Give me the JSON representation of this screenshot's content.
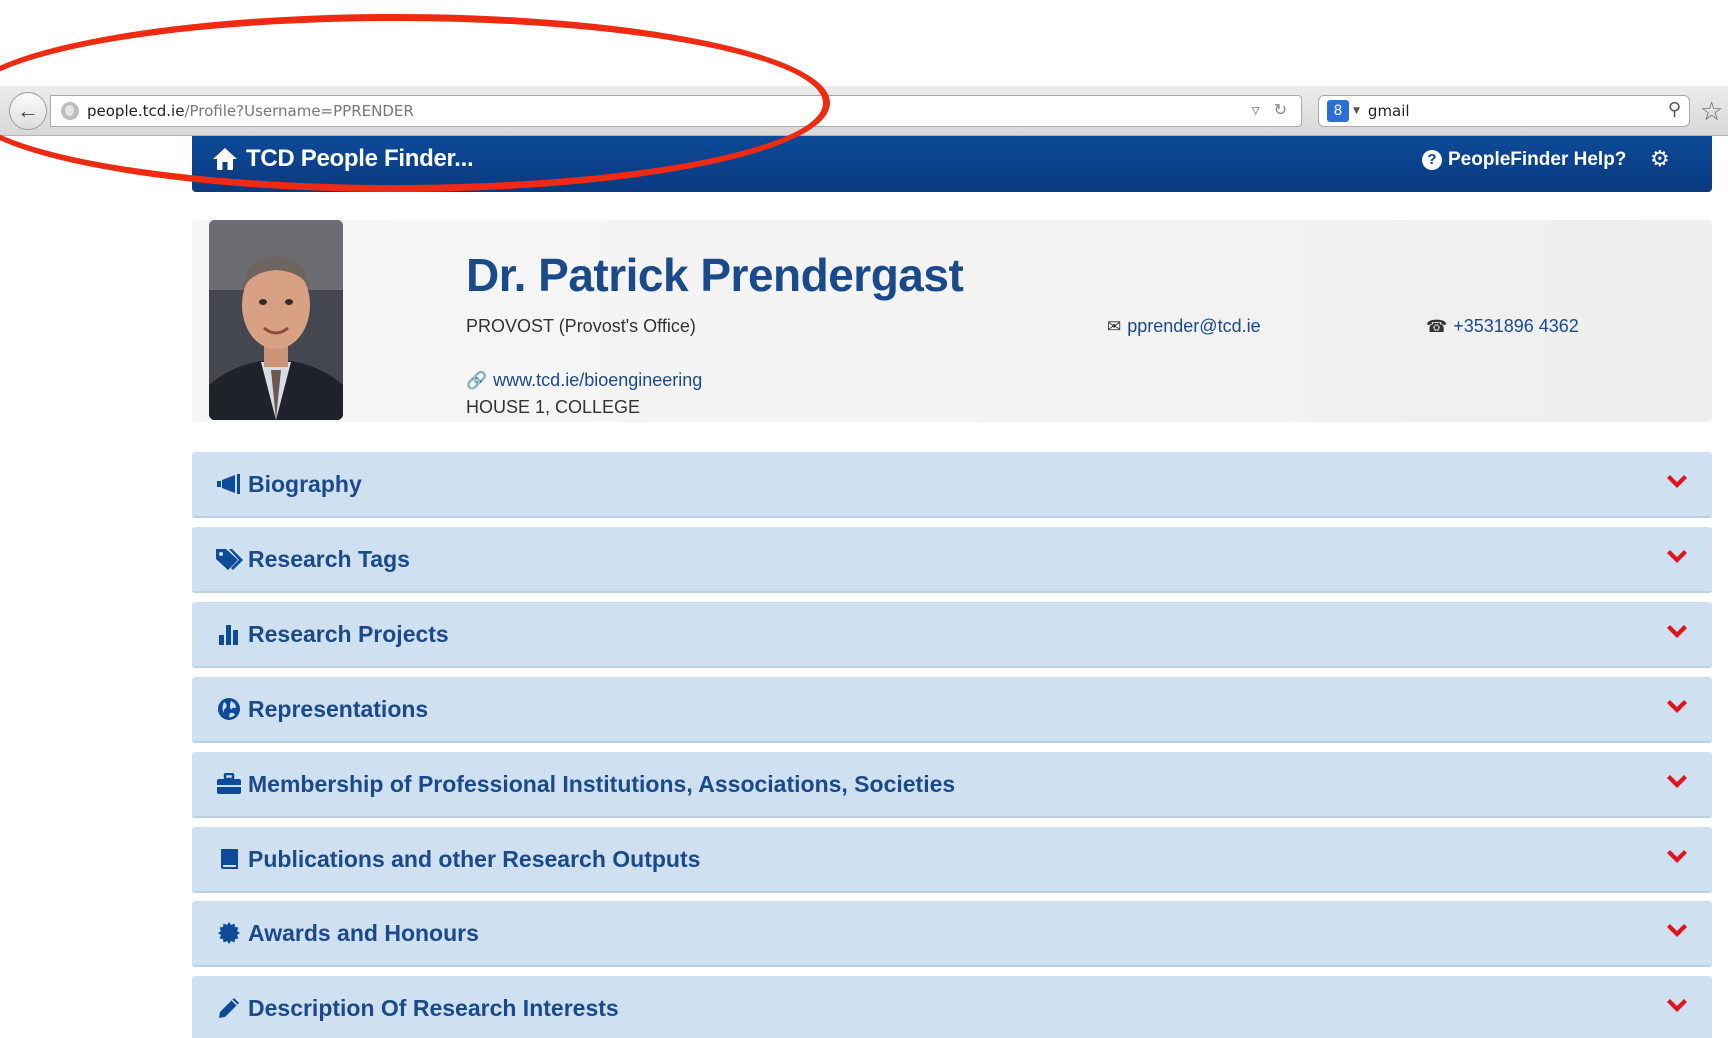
{
  "browser": {
    "url_host": "people.tcd.ie",
    "url_path": "/Profile?Username=PPRENDER",
    "search_value": "gmail"
  },
  "header": {
    "brand": "TCD People Finder...",
    "help": "PeopleFinder Help?"
  },
  "profile": {
    "name": "Dr. Patrick Prendergast",
    "role": "PROVOST (Provost's Office)",
    "email": "pprender@tcd.ie",
    "phone": "+3531896 4362",
    "website": "www.tcd.ie/bioengineering",
    "address": "HOUSE 1, COLLEGE"
  },
  "sections": [
    {
      "label": "Biography",
      "icon": "megaphone-icon"
    },
    {
      "label": "Research Tags",
      "icon": "tags-icon"
    },
    {
      "label": "Research Projects",
      "icon": "bar-chart-icon"
    },
    {
      "label": "Representations",
      "icon": "globe-icon"
    },
    {
      "label": "Membership of Professional Institutions, Associations, Societies",
      "icon": "briefcase-icon"
    },
    {
      "label": "Publications and other Research Outputs",
      "icon": "book-icon"
    },
    {
      "label": "Awards and Honours",
      "icon": "certificate-icon"
    },
    {
      "label": "Description Of Research Interests",
      "icon": "pencil-icon"
    }
  ],
  "colors": {
    "header_blue": "#0d4a98",
    "section_bg": "#cfe0f0",
    "chevron_red": "#e0141e",
    "annotation_red": "#ee2a12"
  }
}
